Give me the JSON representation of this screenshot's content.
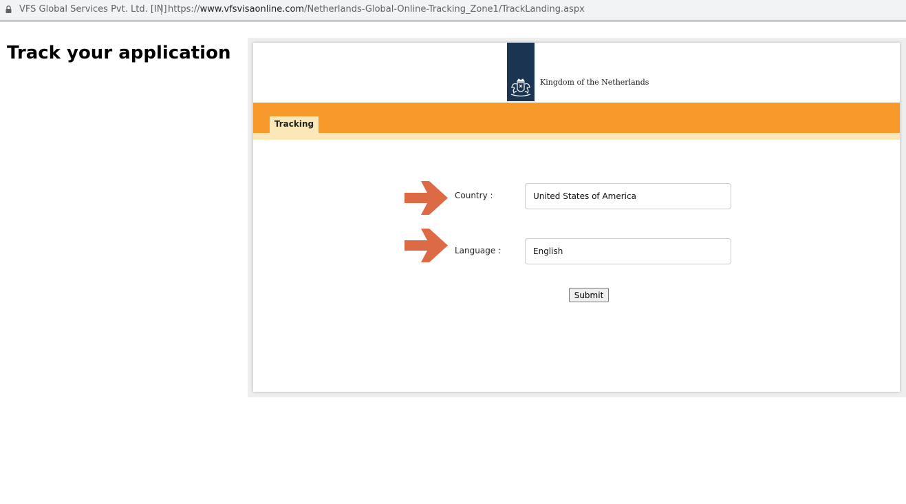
{
  "browser": {
    "site_owner": "VFS Global Services Pvt. Ltd. [IN]",
    "url_scheme": "https://",
    "url_domain": "www.vfsvisaonline.com",
    "url_path": "/Netherlands-Global-Online-Tracking_Zone1/TrackLanding.aspx"
  },
  "page": {
    "title": "Track your application"
  },
  "logo": {
    "text": "Kingdom of the Netherlands",
    "bar_color": "#1b3452"
  },
  "nav": {
    "tab_label": "Tracking",
    "band_color": "#f7982a",
    "tab_color": "#fbe8b9"
  },
  "form": {
    "country_label": "Country :",
    "country_value": "United States of America",
    "language_label": "Language :",
    "language_value": "English",
    "submit_label": "Submit",
    "arrow_color": "#dc6a45"
  }
}
